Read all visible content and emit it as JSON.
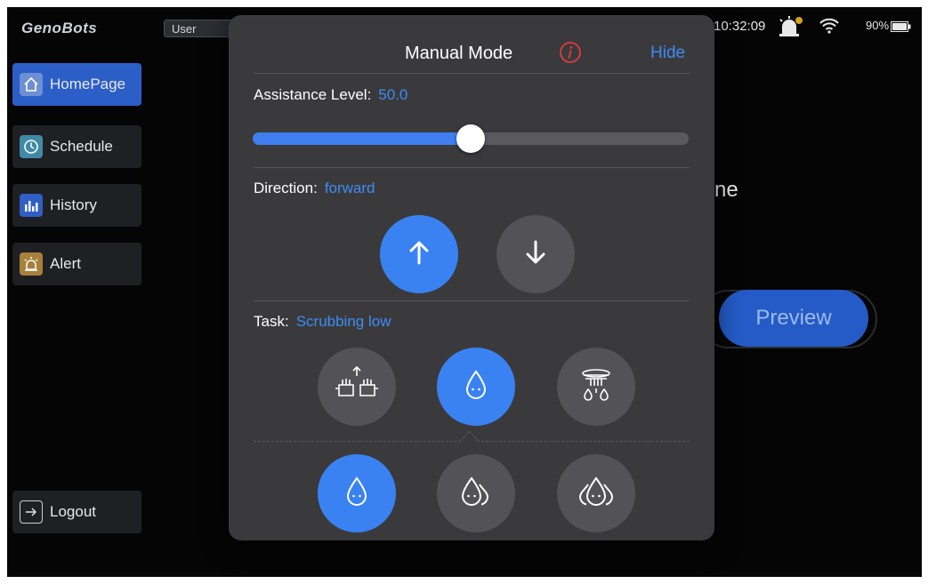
{
  "status_bar": {
    "logo": "GenoBots",
    "user_label": "User",
    "time": "10:32:09",
    "battery_percent": "90%",
    "bell_icon": "alarm-bell-icon",
    "wifi_icon": "wifi-icon",
    "battery_icon": "battery-icon"
  },
  "sidebar": {
    "items": [
      {
        "label": "HomePage",
        "icon": "home-icon",
        "active": true
      },
      {
        "label": "Schedule",
        "icon": "clock-icon",
        "active": false
      },
      {
        "label": "History",
        "icon": "bar-chart-icon",
        "active": false
      },
      {
        "label": "Alert",
        "icon": "alarm-bell-icon",
        "active": false
      }
    ],
    "logout_label": "Logout"
  },
  "background": {
    "title_fragment": "ne",
    "preview_label": "Preview"
  },
  "modal": {
    "title": "Manual Mode",
    "hide_label": "Hide",
    "assistance": {
      "label": "Assistance Level:",
      "value": "50.0",
      "level_fraction": 0.5
    },
    "direction": {
      "label": "Direction:",
      "value": "forward",
      "options": [
        {
          "icon": "arrow-up-icon",
          "active": true
        },
        {
          "icon": "arrow-down-icon",
          "active": false
        }
      ]
    },
    "task": {
      "label": "Task:",
      "value": "Scrubbing low",
      "options": [
        {
          "icon": "hand-scrub-icon",
          "active": false
        },
        {
          "icon": "water-drop-icon",
          "active": true
        },
        {
          "icon": "shower-spray-icon",
          "active": false
        }
      ],
      "levels": [
        {
          "icon": "single-drop-icon",
          "active": true
        },
        {
          "icon": "double-drop-icon",
          "active": false
        },
        {
          "icon": "triple-drop-icon",
          "active": false
        }
      ]
    }
  },
  "colors": {
    "accent": "#3e8bf3",
    "active_button": "#3a82f2",
    "modal_bg": "#3a3a3d",
    "sidebar_active": "#2c5ec8",
    "screen_bg": "#050506"
  }
}
